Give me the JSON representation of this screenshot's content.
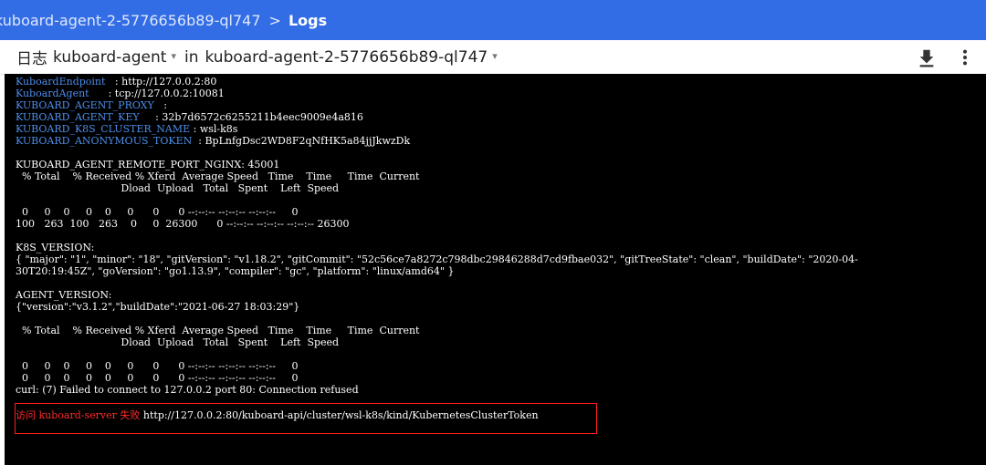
{
  "header": {
    "pod_crumb": "kuboard-agent-2-5776656b89-ql747",
    "separator": ">",
    "current": "Logs"
  },
  "toolbar": {
    "logs_label": "日志",
    "container": "kuboard-agent",
    "in_label": "in",
    "pod": "kuboard-agent-2-5776656b89-ql747",
    "caret": "▾",
    "download_icon": "download-icon",
    "more_icon": "more-vert-icon"
  },
  "colors": {
    "header_bg": "#326de6",
    "terminal_bg": "#000000",
    "env_key": "#4d8eea",
    "error_text": "#ff2a2a",
    "error_box": "#ff1d1d"
  },
  "log": {
    "env": [
      {
        "key": "KuboardEndpoint",
        "value": "   : http://127.0.0.2:80"
      },
      {
        "key": "KuboardAgent",
        "value": "      : tcp://127.0.0.2:10081"
      },
      {
        "key": "KUBOARD_AGENT_PROXY",
        "value": "   :"
      },
      {
        "key": "KUBOARD_AGENT_KEY",
        "value": "     : 32b7d6572c6255211b4eec9009e4a816"
      },
      {
        "key": "KUBOARD_K8S_CLUSTER_NAME",
        "value": " : wsl-k8s"
      },
      {
        "key": "KUBOARD_ANONYMOUS_TOKEN",
        "value": "  : BpLnfgDsc2WD8F2qNfHK5a84jjJkwzDk"
      }
    ],
    "l_port": "KUBOARD_AGENT_REMOTE_PORT_NGINX: 45001",
    "c1_h1": "  % Total    % Received % Xferd  Average Speed   Time    Time     Time  Current",
    "c1_h2": "                                 Dload  Upload   Total   Spent    Left  Speed",
    "c1_r1": "  0     0    0     0    0     0      0      0 --:--:-- --:--:-- --:--:--     0",
    "c1_r2": "100   263  100   263    0     0  26300      0 --:--:-- --:--:-- --:--:-- 26300",
    "k8s_label": "K8S_VERSION:",
    "k8s_line1": "{ \"major\": \"1\", \"minor\": \"18\", \"gitVersion\": \"v1.18.2\", \"gitCommit\": \"52c56ce7a8272c798dbc29846288d7cd9fbae032\", \"gitTreeState\": \"clean\", \"buildDate\": \"2020-04-",
    "k8s_line2": "30T20:19:45Z\", \"goVersion\": \"go1.13.9\", \"compiler\": \"gc\", \"platform\": \"linux/amd64\" }",
    "agent_label": "AGENT_VERSION:",
    "agent_line": "{\"version\":\"v3.1.2\",\"buildDate\":\"2021-06-27 18:03:29\"}",
    "c2_h1": "  % Total    % Received % Xferd  Average Speed   Time    Time     Time  Current",
    "c2_h2": "                                 Dload  Upload   Total   Spent    Left  Speed",
    "c2_r1": "  0     0    0     0    0     0      0      0 --:--:-- --:--:-- --:--:--     0",
    "c2_r2": "  0     0    0     0    0     0      0      0 --:--:-- --:--:-- --:--:--     0",
    "curl_error": "curl: (7) Failed to connect to 127.0.0.2 port 80: Connection refused",
    "fail_prefix": "访问 kuboard-server 失败",
    "fail_url": " http://127.0.0.2:80/kuboard-api/cluster/wsl-k8s/kind/KubernetesClusterToken"
  }
}
